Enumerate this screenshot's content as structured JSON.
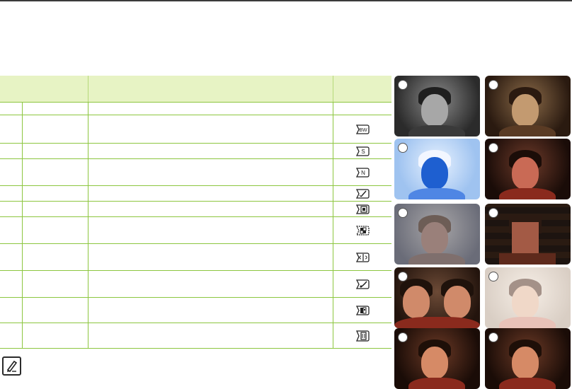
{
  "table": {
    "rows": [
      {
        "icon": "none"
      },
      {
        "icon": "bw-icon"
      },
      {
        "icon": "sepia-icon"
      },
      {
        "icon": "negative-icon"
      },
      {
        "icon": "art-icon"
      },
      {
        "icon": "emboss-icon"
      },
      {
        "icon": "mosaic-icon"
      },
      {
        "icon": "mirror-icon"
      },
      {
        "icon": "pastel-icon"
      },
      {
        "icon": "dual-icon"
      },
      {
        "icon": "vintage-icon"
      }
    ]
  },
  "colors": {
    "header_bg": "#e7f3c4",
    "rule": "#8cc63f",
    "top_rule": "#3a3a3a"
  },
  "thumbnails": [
    {
      "effect": "black-and-white"
    },
    {
      "effect": "sepia"
    },
    {
      "effect": "negative"
    },
    {
      "effect": "art"
    },
    {
      "effect": "emboss"
    },
    {
      "effect": "mosaic"
    },
    {
      "effect": "mirror"
    },
    {
      "effect": "pastel"
    },
    {
      "effect": "normal"
    },
    {
      "effect": "normal"
    }
  ]
}
